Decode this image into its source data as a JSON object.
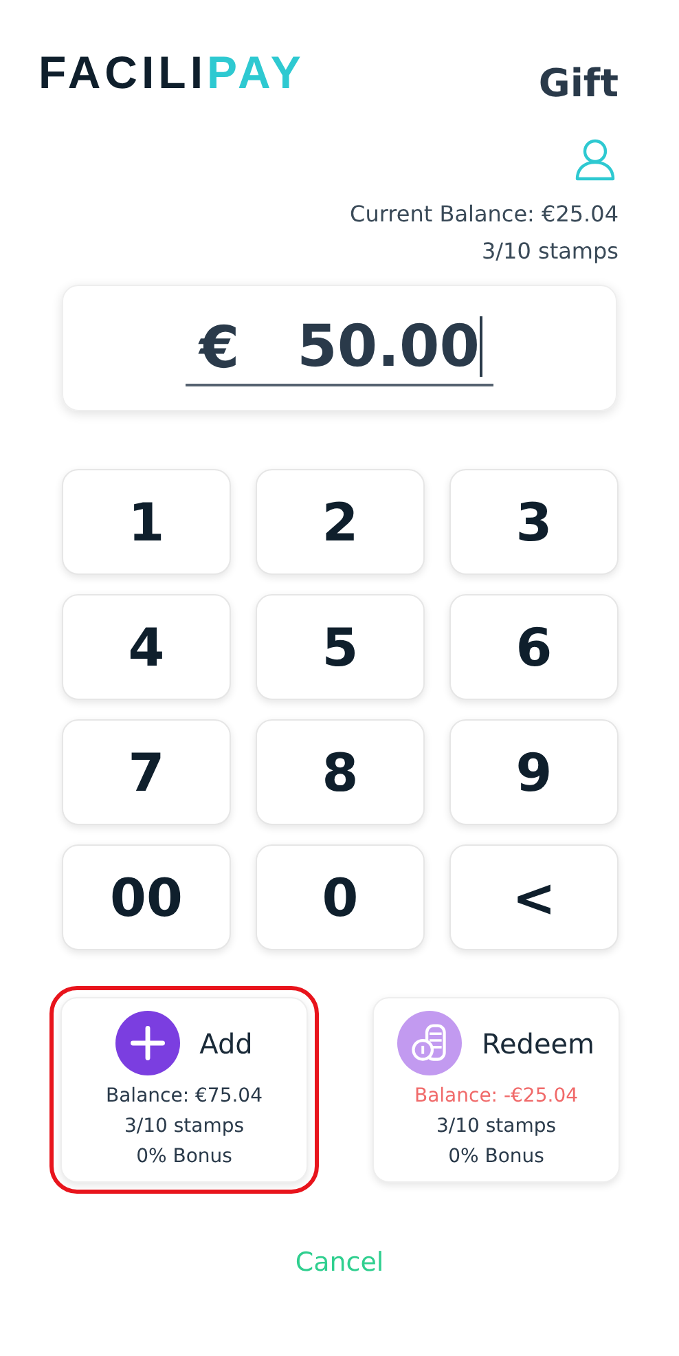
{
  "header": {
    "logo": {
      "dark": "FACILI",
      "accent": "PAY"
    },
    "title": "Gift"
  },
  "customer": {
    "balance": "Current Balance: €25.04",
    "stamps": "3/10 stamps"
  },
  "amount": {
    "currency": "€",
    "value": "50.00"
  },
  "keypad": [
    "1",
    "2",
    "3",
    "4",
    "5",
    "6",
    "7",
    "8",
    "9",
    "00",
    "0",
    "<"
  ],
  "actions": [
    {
      "kind": "add",
      "label": "Add",
      "balance": "Balance: €75.04",
      "negative": false,
      "stamps": "3/10 stamps",
      "bonus": "0% Bonus",
      "selected": true
    },
    {
      "kind": "redeem",
      "label": "Redeem",
      "balance": "Balance: -€25.04",
      "negative": true,
      "stamps": "3/10 stamps",
      "bonus": "0% Bonus",
      "selected": false
    }
  ],
  "cancel": "Cancel"
}
